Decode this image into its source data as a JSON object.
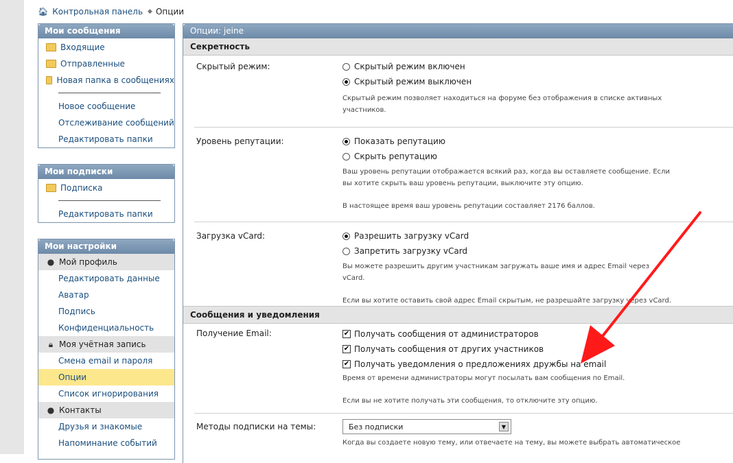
{
  "breadcrumb": {
    "home": "Контрольная панель",
    "current": "Опции"
  },
  "sidebar": {
    "messages": {
      "title": "Мои сообщения",
      "folders": [
        "Входящие",
        "Отправленные",
        "Новая папка в сообщениях"
      ],
      "links": [
        "Новое сообщение",
        "Отслеживание сообщений",
        "Редактировать папки"
      ]
    },
    "subscriptions": {
      "title": "Мои подписки",
      "folders": [
        "Подписка"
      ],
      "links": [
        "Редактировать папки"
      ]
    },
    "settings": {
      "title": "Мои настройки",
      "profile": {
        "title": "Мой профиль",
        "links": [
          "Редактировать данные",
          "Аватар",
          "Подпись",
          "Конфиденциальность"
        ]
      },
      "account": {
        "title": "Моя учётная запись",
        "links": [
          "Смена email и пароля",
          "Опции",
          "Список игнорирования"
        ]
      },
      "contacts": {
        "title": "Контакты",
        "links": [
          "Друзья и знакомые",
          "Напоминание событий"
        ]
      }
    }
  },
  "main": {
    "title": "Опции: jeine",
    "privacy": {
      "title": "Секретность",
      "hidden": {
        "label": "Скрытый режим:",
        "on": "Скрытый режим включен",
        "off": "Скрытый режим выключен",
        "desc": "Скрытый режим позволяет находиться на форуме без отображения в списке активных участников."
      },
      "reputation": {
        "label": "Уровень репутации:",
        "show": "Показать репутацию",
        "hide": "Скрыть репутацию",
        "desc": "Ваш уровень репутации отображается всякий раз, когда вы оставляете сообщение. Если вы хотите скрыть ваш уровень репутации, выключите эту опцию.",
        "current": "В настоящее время ваш уровень репутации составляет 2176 баллов."
      },
      "vcard": {
        "label": "Загрузка vCard:",
        "allow": "Разрешить загрузку vCard",
        "deny": "Запретить загрузку vCard",
        "desc": "Вы можете разрешить другим участникам загружать ваше имя и адрес Email через vCard.",
        "desc2": "Если вы хотите оставить свой адрес Email скрытым, не разрешайте загрузку через vCard."
      }
    },
    "notifications": {
      "title": "Сообщения и уведомления",
      "email": {
        "label": "Получение Email:",
        "opt1": "Получать сообщения от администраторов",
        "opt2": "Получать сообщения от других участников",
        "opt3": "Получать уведомления о предложениях дружбы на email",
        "desc": "Время от времени администраторы могут посылать вам сообщения по Email.",
        "desc2": "Если вы не хотите получать эти сообщения, то отключите эту опцию."
      },
      "subscribe": {
        "label": "Методы подписки на темы:",
        "value": "Без подписки",
        "desc": "Когда вы создаете новую тему, или отвечаете на тему, вы можете выбрать автоматическое"
      }
    }
  },
  "colors": {
    "link": "#1a4e7d",
    "header": "#7b93ad",
    "active": "#fde78d",
    "arrow": "#ff1a1a"
  }
}
